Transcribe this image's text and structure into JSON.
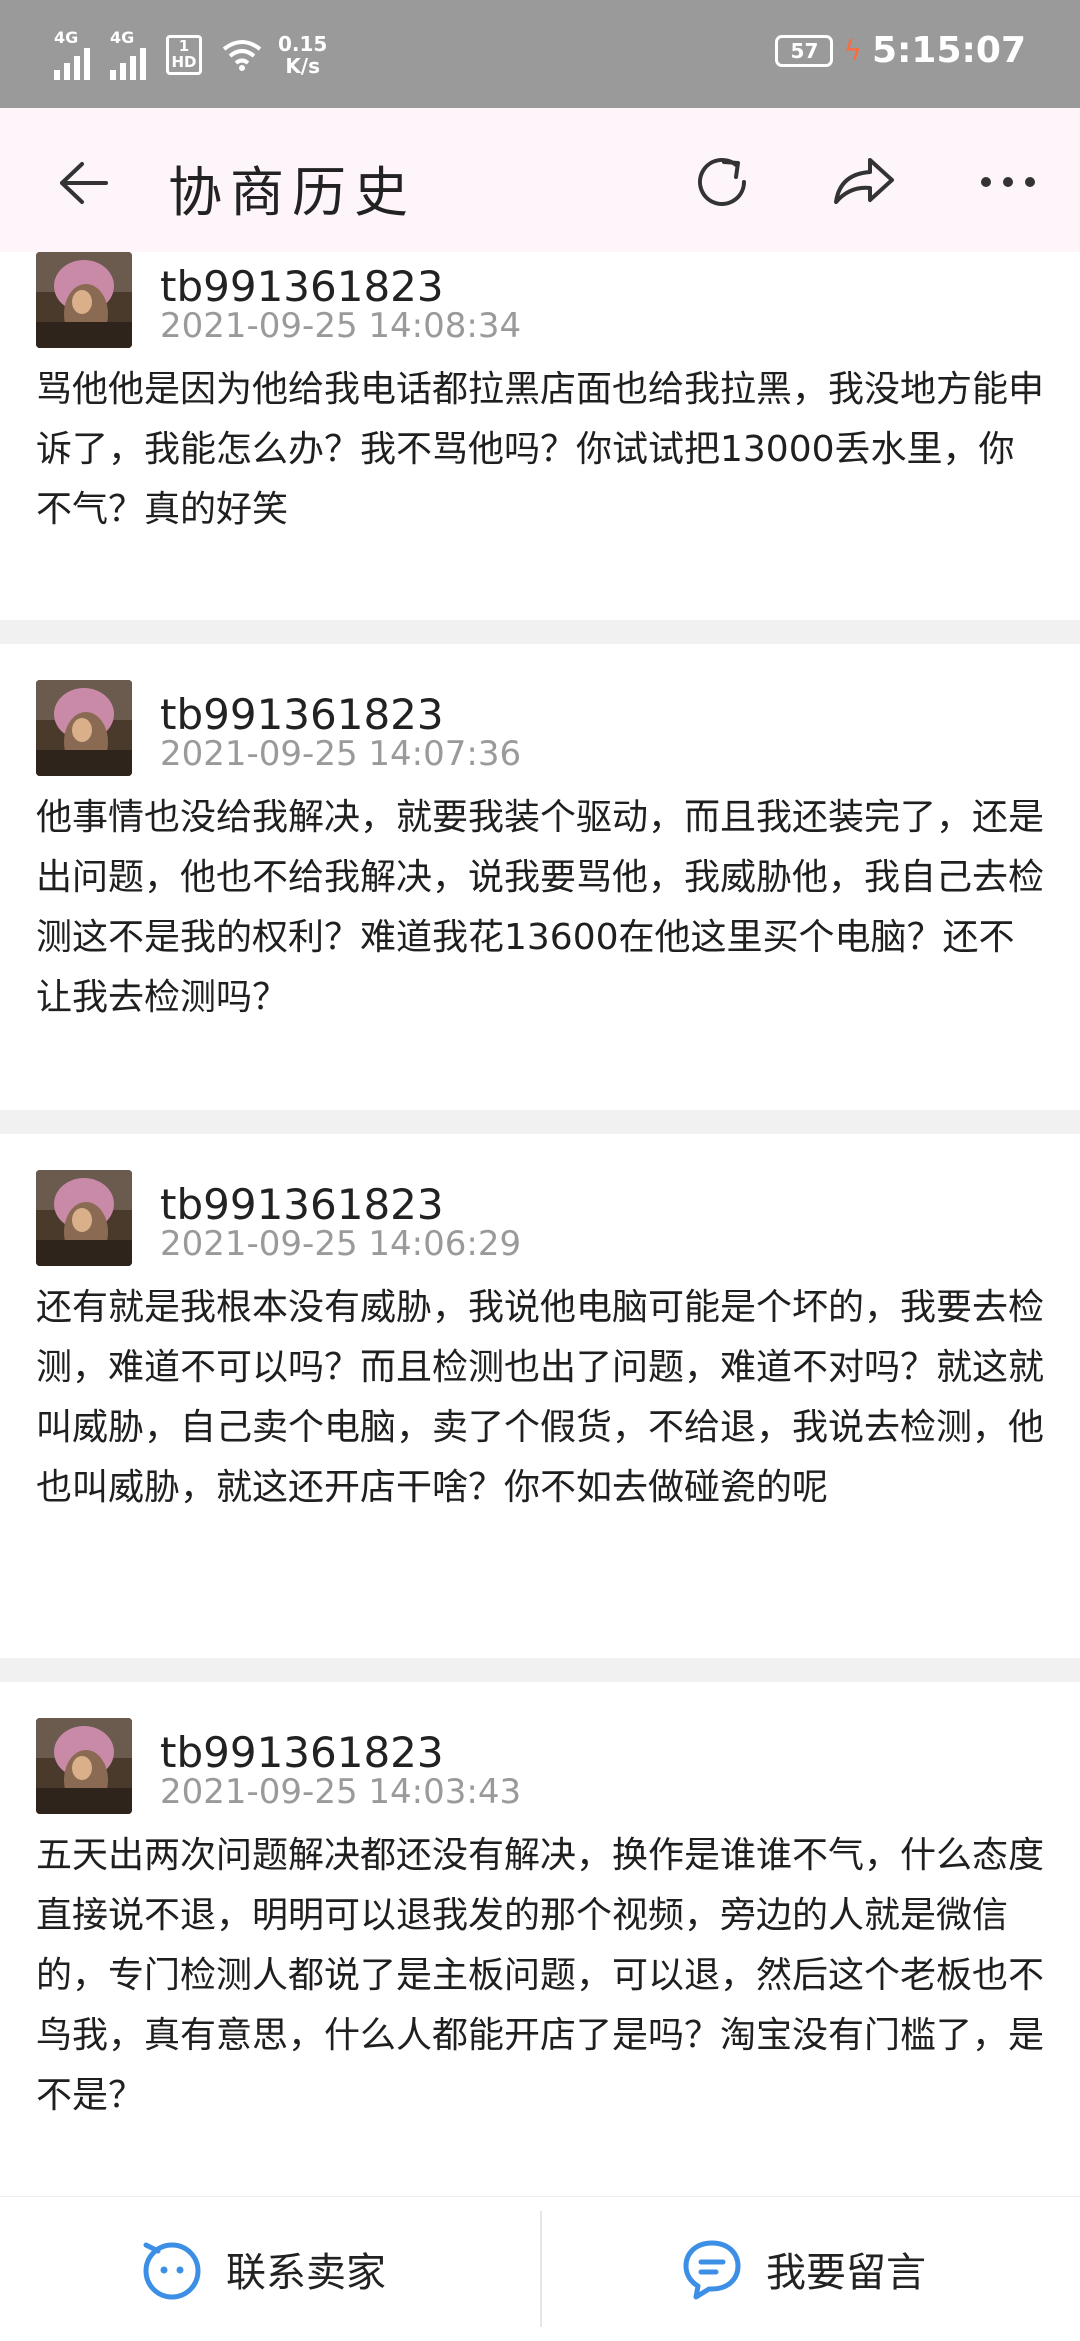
{
  "status_bar": {
    "network1": "4G",
    "network2": "4G",
    "hd_top": "1",
    "hd_bottom": "HD",
    "speed_value": "0.15",
    "speed_unit": "K/s",
    "battery": "57",
    "time": "5:15:07"
  },
  "header": {
    "title": "协商历史"
  },
  "messages": [
    {
      "user": "tb991361823",
      "time": "2021-09-25 14:08:34",
      "text": "骂他他是因为他给我电话都拉黑店面也给我拉黑，我没地方能申诉了，我能怎么办？我不骂他吗？你试试把13000丢水里，你不气？真的好笑"
    },
    {
      "user": "tb991361823",
      "time": "2021-09-25 14:07:36",
      "text": "他事情也没给我解决，就要我装个驱动，而且我还装完了，还是出问题，他也不给我解决，说我要骂他，我威胁他，我自己去检测这不是我的权利？难道我花13600在他这里买个电脑？还不让我去检测吗？"
    },
    {
      "user": "tb991361823",
      "time": "2021-09-25 14:06:29",
      "text": "还有就是我根本没有威胁，我说他电脑可能是个坏的，我要去检测，难道不可以吗？而且检测也出了问题，难道不对吗？就这就叫威胁，自己卖个电脑，卖了个假货，不给退，我说去检测，他也叫威胁，就这还开店干啥？你不如去做碰瓷的呢"
    },
    {
      "user": "tb991361823",
      "time": "2021-09-25 14:03:43",
      "text": "五天出两次问题解决都还没有解决，换作是谁谁不气，什么态度直接说不退，明明可以退我发的那个视频，旁边的人就是微信的，专门检测人都说了是主板问题，可以退，然后这个老板也不鸟我，真有意思，什么人都能开店了是吗？淘宝没有门槛了，是不是？"
    }
  ],
  "bottom_bar": {
    "contact_label": "联系卖家",
    "comment_label": "我要留言"
  },
  "colors": {
    "header_bg": "#fdf5fa",
    "status_bg": "#9a9a9a",
    "accent_blue": "#3d8fe6",
    "separator": "#f1f1f1"
  }
}
